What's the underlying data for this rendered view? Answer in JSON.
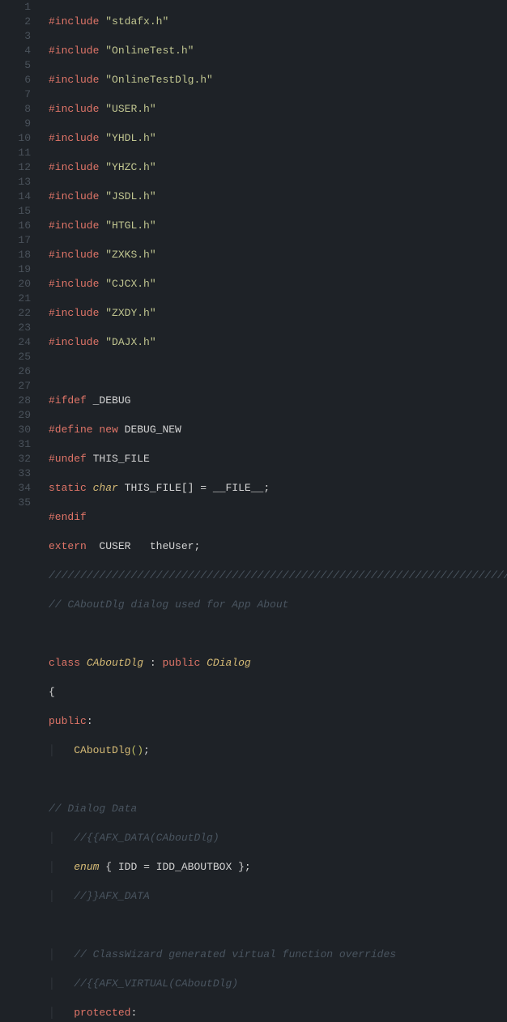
{
  "lines": {
    "l1": {
      "include": "#include",
      "header": "\"stdafx.h\""
    },
    "l2": {
      "include": "#include",
      "header": "\"OnlineTest.h\""
    },
    "l3": {
      "include": "#include",
      "header": "\"OnlineTestDlg.h\""
    },
    "l4": {
      "include": "#include",
      "header": "\"USER.h\""
    },
    "l5": {
      "include": "#include",
      "header": "\"YHDL.h\""
    },
    "l6": {
      "include": "#include",
      "header": "\"YHZC.h\""
    },
    "l7": {
      "include": "#include",
      "header": "\"JSDL.h\""
    },
    "l8": {
      "include": "#include",
      "header": "\"HTGL.h\""
    },
    "l9": {
      "include": "#include",
      "header": "\"ZXKS.h\""
    },
    "l10": {
      "include": "#include",
      "header": "\"CJCX.h\""
    },
    "l11": {
      "include": "#include",
      "header": "\"ZXDY.h\""
    },
    "l12": {
      "include": "#include",
      "header": "\"DAJX.h\""
    },
    "l14": {
      "ifdef": "#ifdef",
      "sym": "_DEBUG"
    },
    "l15": {
      "define": "#define",
      "name": "new",
      "value": "DEBUG_NEW"
    },
    "l16": {
      "undef": "#undef",
      "sym": "THIS_FILE"
    },
    "l17": {
      "static": "static",
      "char": "char",
      "arr": "THIS_FILE[] ",
      "eq": "=",
      "val": " __FILE__",
      "semi": ";"
    },
    "l18": {
      "endif": "#endif"
    },
    "l19": {
      "extern": "extern",
      "type": "CUSER",
      "name": "theUser",
      "semi": ";"
    },
    "l20": {
      "slashes": "//////////////////////////////////////////////////////////////////////////////////////"
    },
    "l21": {
      "comment": "// CAboutDlg dialog used for App About"
    },
    "l23": {
      "class": "class",
      "name": "CAboutDlg",
      "colon": " :",
      "public": "public",
      "base": "CDialog"
    },
    "l24": {
      "brace": "{"
    },
    "l25": {
      "public": "public",
      "colon": ":"
    },
    "l26": {
      "ctor": "CAboutDlg",
      "paren": "()",
      "semi": ";"
    },
    "l28": {
      "comment": "// Dialog Data"
    },
    "l29": {
      "comment": "//{{AFX_DATA(CAboutDlg)"
    },
    "l30": {
      "enum": "enum",
      "open": "{ ",
      "idd": "IDD",
      "eq": " = ",
      "val": "IDD_ABOUTBOX",
      "close": " }",
      "semi": ";"
    },
    "l31": {
      "comment": "//}}AFX_DATA"
    },
    "l33": {
      "comment": "// ClassWizard generated virtual function overrides"
    },
    "l34": {
      "comment": "//{{AFX_VIRTUAL(CAboutDlg)"
    },
    "l35": {
      "protected": "protected",
      "colon": ":"
    }
  },
  "gutter": [
    "1",
    "2",
    "3",
    "4",
    "5",
    "6",
    "7",
    "8",
    "9",
    "10",
    "11",
    "12",
    "13",
    "14",
    "15",
    "16",
    "17",
    "18",
    "19",
    "20",
    "21",
    "22",
    "23",
    "24",
    "25",
    "26",
    "27",
    "28",
    "29",
    "30",
    "31",
    "32",
    "33",
    "34",
    "35"
  ]
}
